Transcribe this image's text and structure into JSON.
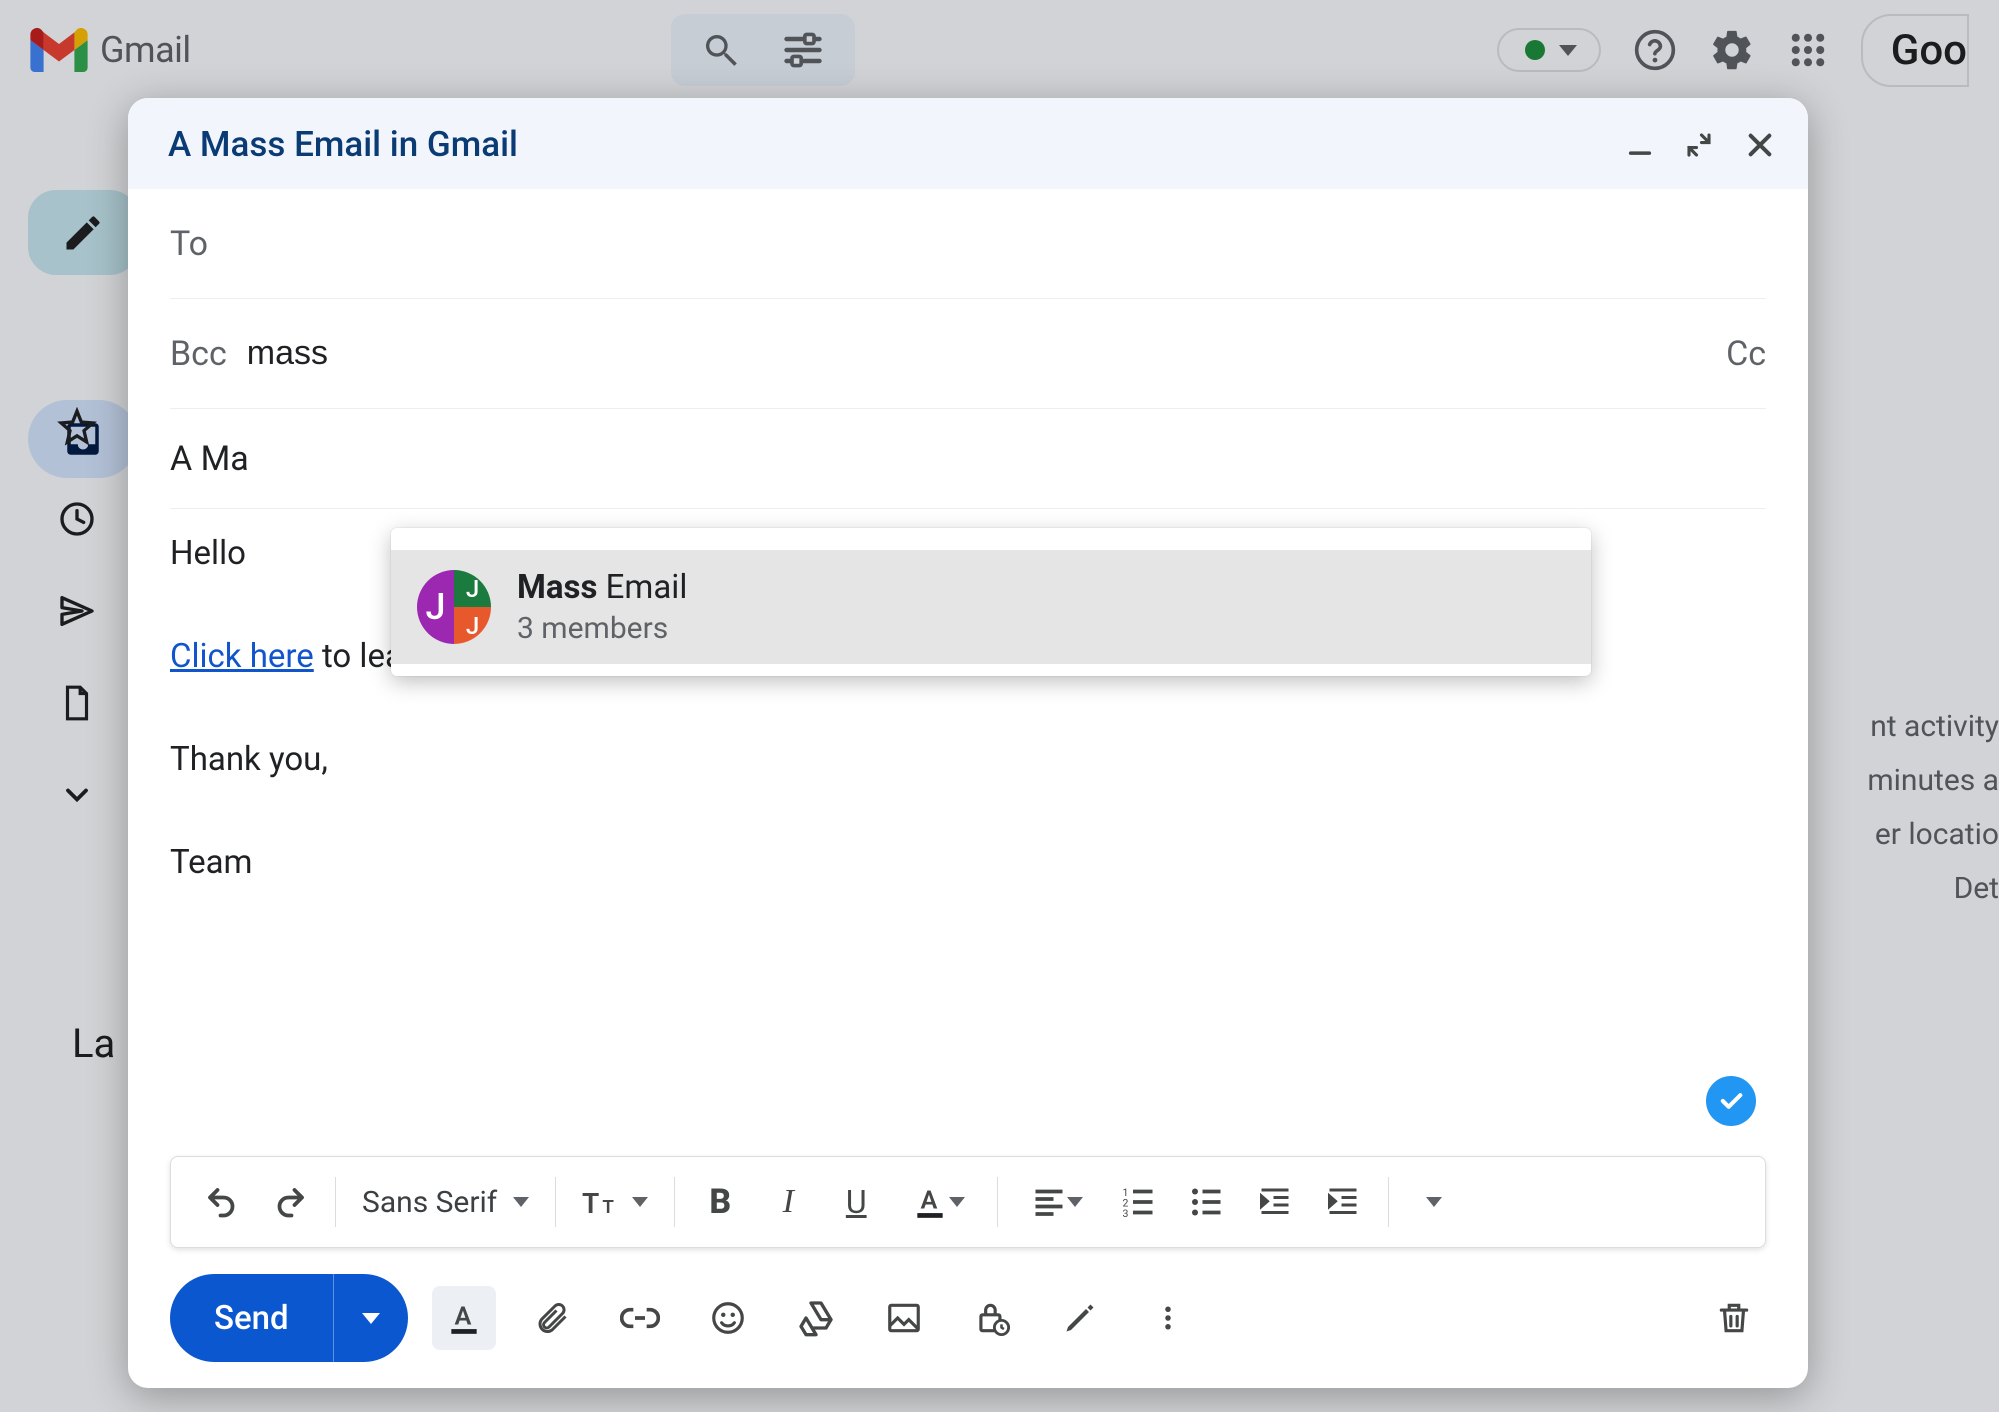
{
  "app": {
    "name": "Gmail",
    "status": "active",
    "truncated_account": "Goo"
  },
  "leftnav": {
    "truncated_label": "La"
  },
  "rightpeek": {
    "line1": "nt activity",
    "line2": "minutes a",
    "line3": "er locatio",
    "line4": "Det"
  },
  "compose": {
    "title": "A Mass Email in Gmail",
    "to_label": "To",
    "bcc_label": "Bcc",
    "bcc_value": "mass",
    "cc_label": "Cc",
    "subject_fragment": "A Ma",
    "body": {
      "greeting": "Hello",
      "link_text": "Click here",
      "link_rest": " to learn how to send a mass email in Gmail.",
      "closing": "Thank you,",
      "signature": "Team"
    },
    "suggestion": {
      "match_bold": "Mass",
      "match_rest": " Email",
      "sub": "3 members",
      "avatar_letters": {
        "left": "J",
        "topright": "J",
        "bottomright": "J"
      }
    },
    "format_font": "Sans Serif",
    "send_label": "Send"
  }
}
